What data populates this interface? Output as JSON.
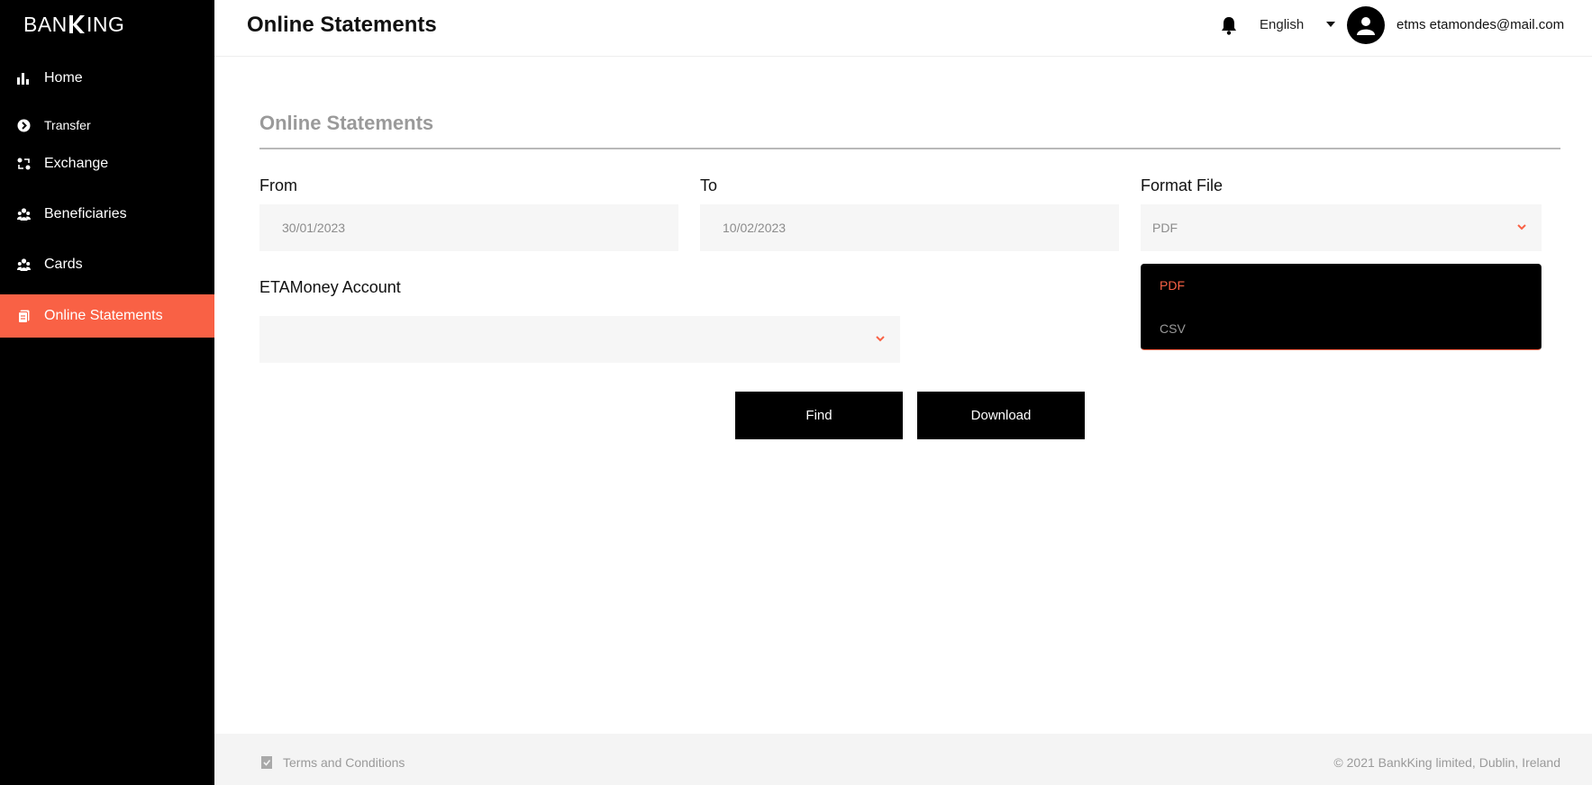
{
  "brand": {
    "logo_text": "BANKING"
  },
  "sidebar": {
    "items": [
      {
        "label": "Home",
        "icon": "bar-chart-icon"
      },
      {
        "label": "Transfer",
        "icon": "arrow-circle-icon"
      },
      {
        "label": "Exchange",
        "icon": "exchange-icon"
      },
      {
        "label": "Beneficiaries",
        "icon": "people-icon"
      },
      {
        "label": "Cards",
        "icon": "people-icon"
      },
      {
        "label": "Online Statements",
        "icon": "document-icon",
        "active": true
      }
    ]
  },
  "header": {
    "title": "Online Statements",
    "language": "English",
    "user": "etms etamondes@mail.com"
  },
  "main": {
    "section_title": "Online Statements",
    "from": {
      "label": "From",
      "value": "30/01/2023"
    },
    "to": {
      "label": "To",
      "value": "10/02/2023"
    },
    "format": {
      "label": "Format File",
      "value": "PDF",
      "options": [
        "PDF",
        "CSV"
      ]
    },
    "account": {
      "label": "ETAMoney Account",
      "value": ""
    },
    "find_label": "Find",
    "download_label": "Download"
  },
  "footer": {
    "terms": "Terms and Conditions",
    "copyright": "© 2021 BankKing limited, Dublin, Ireland"
  },
  "colors": {
    "accent": "#f96145",
    "sidebar_bg": "#000000",
    "field_bg": "#f6f6f6"
  }
}
